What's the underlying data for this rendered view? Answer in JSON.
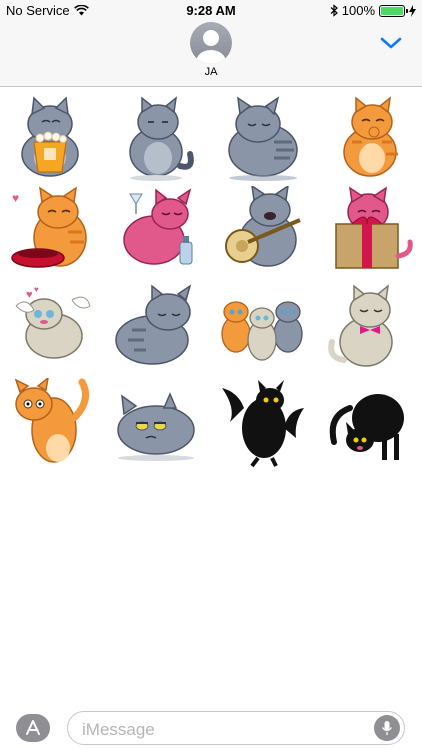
{
  "status_bar": {
    "carrier": "No Service",
    "time": "9:28 AM",
    "battery_percent": "100%",
    "wifi_icon": "wifi-icon",
    "bluetooth_icon": "bluetooth-icon",
    "charging_icon": "bolt-icon",
    "battery_level": 1.0
  },
  "header": {
    "contact_name": "JA",
    "avatar_icon": "person-silhouette-icon",
    "collapse_icon": "chevron-down-icon"
  },
  "sticker_grid": {
    "stickers": [
      {
        "name": "grey-cat-popcorn",
        "color": "#8a96a8"
      },
      {
        "name": "grey-cat-sitting",
        "color": "#8a96a8"
      },
      {
        "name": "grey-cat-content",
        "color": "#8a96a8"
      },
      {
        "name": "orange-cat-thinking",
        "color": "#f39a3c"
      },
      {
        "name": "orange-cat-food-bowl",
        "color": "#f39a3c"
      },
      {
        "name": "pink-cat-drinking",
        "color": "#e0598a"
      },
      {
        "name": "grey-cat-banjo",
        "color": "#8a96a8"
      },
      {
        "name": "pink-cat-gift-box",
        "color": "#e0598a"
      },
      {
        "name": "angel-cat",
        "color": "#d9d4c4"
      },
      {
        "name": "grey-cat-lying",
        "color": "#8a96a8"
      },
      {
        "name": "three-cats",
        "color": "#f39a3c"
      },
      {
        "name": "cream-cat-bow",
        "color": "#d9d4c4"
      },
      {
        "name": "orange-cat-jumping",
        "color": "#f39a3c"
      },
      {
        "name": "grumpy-grey-cat",
        "color": "#8a96a8"
      },
      {
        "name": "black-cat-bat",
        "color": "#111111"
      },
      {
        "name": "black-cat-crouching",
        "color": "#111111"
      }
    ]
  },
  "input_bar": {
    "placeholder": "iMessage",
    "apps_icon": "app-store-icon",
    "mic_icon": "microphone-icon"
  },
  "colors": {
    "accent": "#0a7aff",
    "header_bg": "#f7f7f7",
    "grey_button": "#8e8e93",
    "battery_green": "#4cd964"
  }
}
